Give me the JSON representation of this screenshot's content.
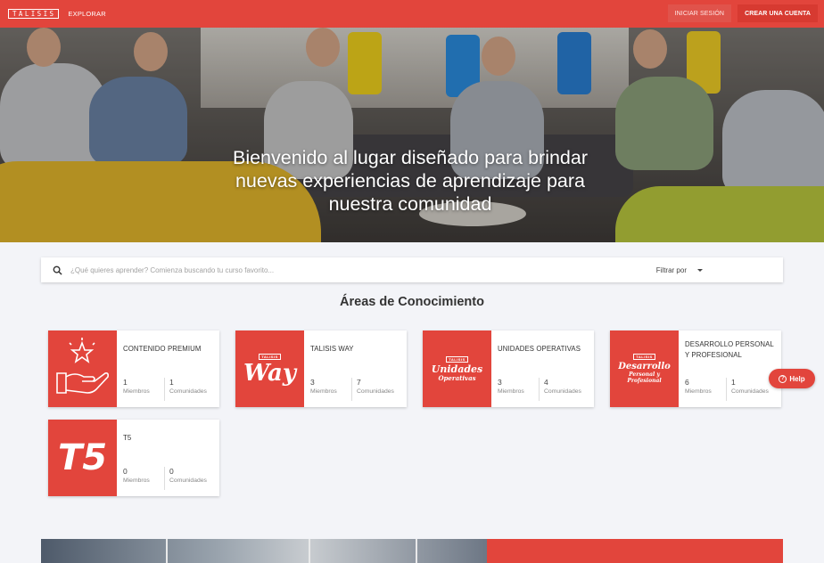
{
  "nav": {
    "logo": "TALISIS",
    "explore": "EXPLORAR",
    "login": "INICIAR SESIÓN",
    "signup": "CREAR UNA CUENTA"
  },
  "hero": {
    "title": "Bienvenido al lugar diseñado para brindar nuevas experiencias de aprendizaje para nuestra comunidad"
  },
  "search": {
    "placeholder": "¿Qué quieres aprender? Comienza buscando tu curso favorito...",
    "filter_label": "Filtrar por"
  },
  "section": {
    "title": "Áreas de Conocimiento"
  },
  "cards": [
    {
      "name": "CONTENIDO PREMIUM",
      "members": "1",
      "members_label": "Miembros",
      "communities": "1",
      "communities_label": "Comunidades",
      "thumb": "hand-star-icon"
    },
    {
      "name": "TALISIS WAY",
      "members": "3",
      "members_label": "Miembros",
      "communities": "7",
      "communities_label": "Comunidades",
      "thumb_tag": "TALISIS",
      "thumb_text": "Way"
    },
    {
      "name": "UNIDADES OPERATIVAS",
      "members": "3",
      "members_label": "Miembros",
      "communities": "4",
      "communities_label": "Comunidades",
      "thumb_tag": "TALISIS",
      "thumb_text": "Unidades",
      "thumb_sub": "Operativas"
    },
    {
      "name": "DESARROLLO PERSONAL Y PROFESIONAL",
      "members": "6",
      "members_label": "Miembros",
      "communities": "1",
      "communities_label": "Comunidades",
      "thumb_tag": "TALISIS",
      "thumb_text": "Desarrollo",
      "thumb_sub": "Personal y Profesional"
    },
    {
      "name": "T5",
      "members": "0",
      "members_label": "Miembros",
      "communities": "0",
      "communities_label": "Comunidades",
      "thumb_text": "T5"
    }
  ],
  "help": {
    "label": "Help"
  },
  "colors": {
    "brand": "#e2453c",
    "background": "#f3f4f8"
  }
}
